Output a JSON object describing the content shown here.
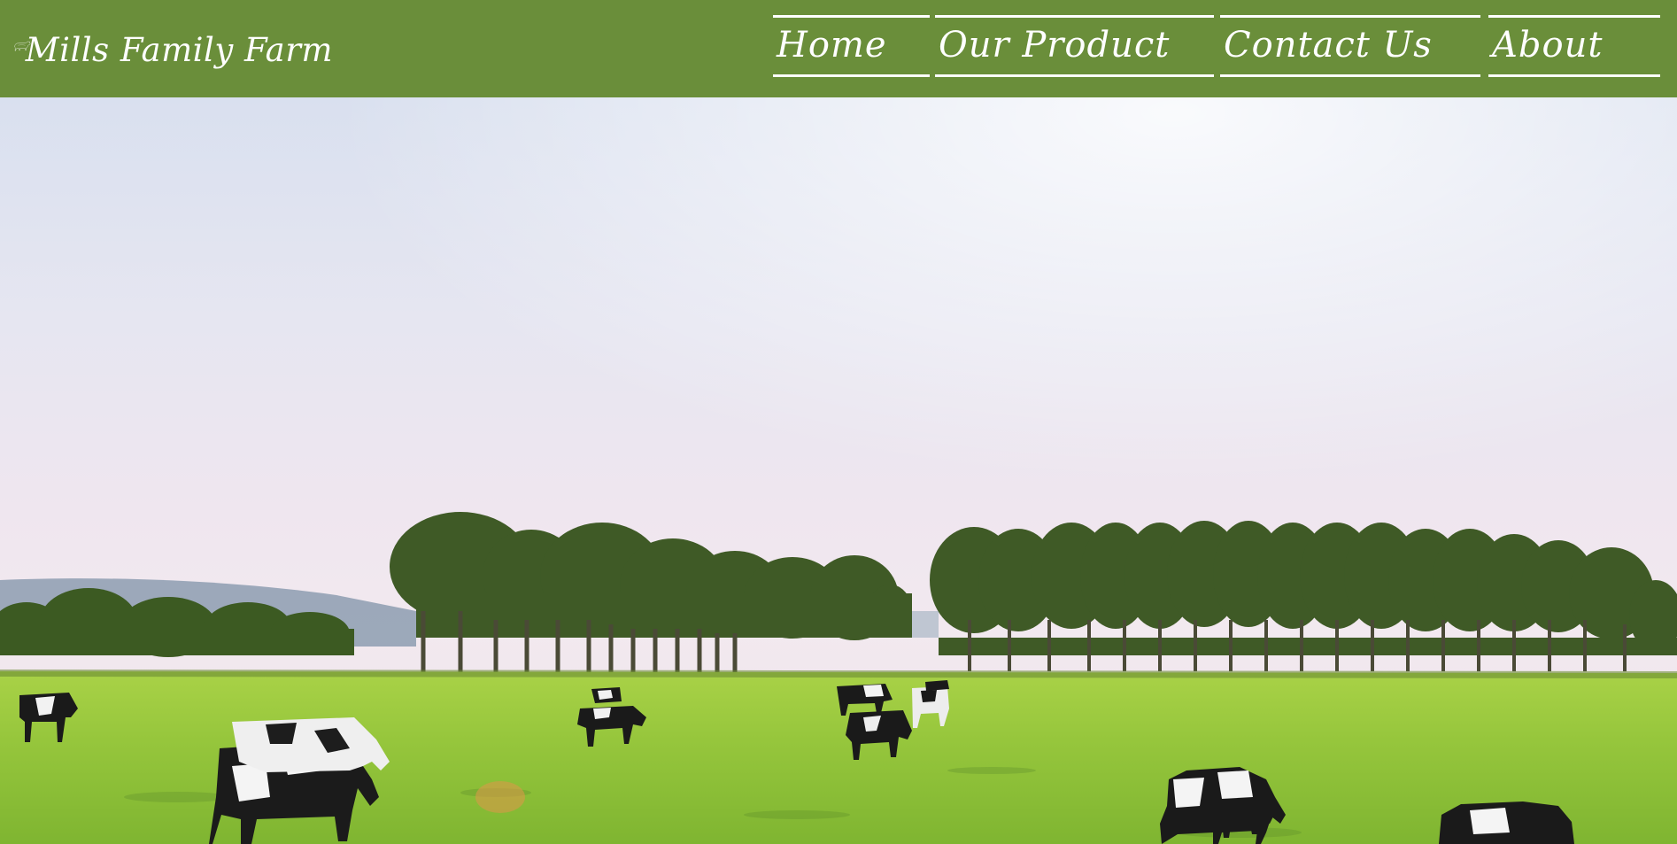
{
  "brand": {
    "name": "Mills Family Farm",
    "logo_icon": "cow-outline-icon"
  },
  "nav": {
    "items": [
      {
        "label": "Home"
      },
      {
        "label": "Our Product"
      },
      {
        "label": "Contact Us"
      },
      {
        "label": "About"
      }
    ]
  },
  "hero": {
    "image": "cows-grazing-in-pasture-photo"
  },
  "colors": {
    "header_bg": "#6a8e3a",
    "nav_text": "#ffffff",
    "grass": "#8fc33a",
    "trees": "#3f5a26"
  }
}
